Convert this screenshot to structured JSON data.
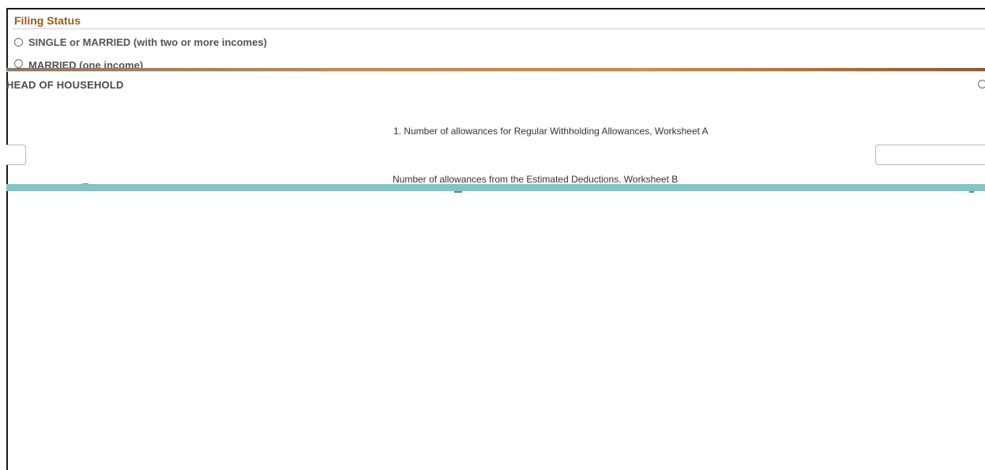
{
  "filing_status": {
    "title": "Filing Status",
    "options": [
      {
        "label": "SINGLE or MARRIED (with two or more incomes)"
      },
      {
        "label": "MARRIED (one income)"
      },
      {
        "label": "HEAD OF HOUSEHOLD"
      }
    ]
  },
  "allowances": {
    "line1_label": "1. Number of allowances for Regular Withholding Allowances, Worksheet A",
    "line1_value": "",
    "line2_label": "Number of allowances from the Estimated Deductions. Worksheet B",
    "line2_value": ""
  },
  "colors": {
    "section_title": "#9b5a1a",
    "teal_band": "#82c4c0",
    "border": "#b8b8b8"
  }
}
